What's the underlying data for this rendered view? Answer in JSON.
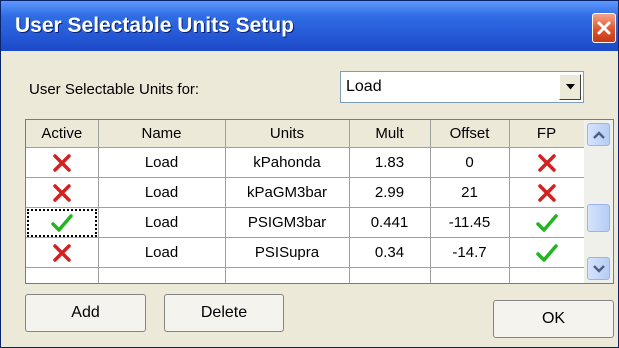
{
  "window": {
    "title": "User Selectable Units Setup"
  },
  "selector": {
    "label": "User Selectable Units for:",
    "value": "Load"
  },
  "table": {
    "columns": [
      "Active",
      "Name",
      "Units",
      "Mult",
      "Offset",
      "FP"
    ],
    "rows": [
      {
        "active": "cross",
        "name": "Load",
        "units": "kPahonda",
        "mult": "1.83",
        "offset": "0",
        "fp": "cross"
      },
      {
        "active": "cross",
        "name": "Load",
        "units": "kPaGM3bar",
        "mult": "2.99",
        "offset": "21",
        "fp": "cross"
      },
      {
        "active": "check",
        "name": "Load",
        "units": "PSIGM3bar",
        "mult": "0.441",
        "offset": "-11.45",
        "fp": "check"
      },
      {
        "active": "cross",
        "name": "Load",
        "units": "PSISupra",
        "mult": "0.34",
        "offset": "-14.7",
        "fp": "check"
      }
    ]
  },
  "buttons": {
    "add": "Add",
    "delete": "Delete",
    "ok": "OK"
  },
  "colors": {
    "cross": "#d42020",
    "check": "#22b522",
    "titlebar": "#2558d6"
  },
  "icons": {
    "close": "close-icon",
    "dropdown": "chevron-down-icon",
    "cross": "cross-icon",
    "check": "check-icon"
  }
}
